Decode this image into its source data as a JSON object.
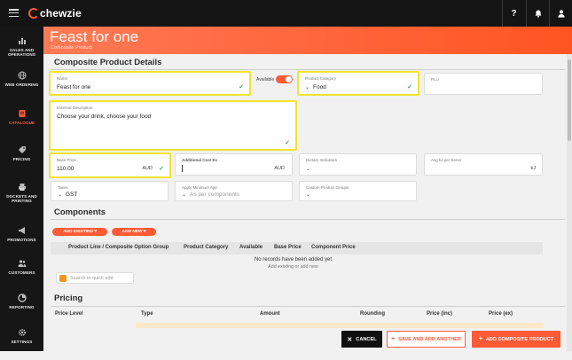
{
  "app": {
    "logo_text": "chewzie"
  },
  "header": {
    "title": "Feast for one",
    "subtitle": "Composite Product"
  },
  "sidebar": {
    "items": [
      {
        "label": "SALES AND OPERATIONS",
        "icon": "chart-icon"
      },
      {
        "label": "WEB ORDERING",
        "icon": "globe-icon"
      },
      {
        "label": "CATALOGUE",
        "icon": "catalogue-icon",
        "active": true
      },
      {
        "label": "PRICING",
        "icon": "tag-icon"
      },
      {
        "label": "DOCKETS AND PRINTING",
        "icon": "printer-icon"
      },
      {
        "label": "PROMOTIONS",
        "icon": "megaphone-icon"
      },
      {
        "label": "CUSTOMERS",
        "icon": "people-icon"
      },
      {
        "label": "REPORTING",
        "icon": "report-icon"
      },
      {
        "label": "SETTINGS",
        "icon": "gear-icon"
      }
    ]
  },
  "details": {
    "section_title": "Composite Product Details",
    "name": {
      "label": "Name",
      "value": "Feast for one"
    },
    "available": {
      "label": "Available",
      "on": true
    },
    "category": {
      "label": "Product Category",
      "value": "Food"
    },
    "plu": {
      "label": "PLU",
      "value": ""
    },
    "description": {
      "label": "External Description",
      "value": "Choose your drink, choose your food"
    },
    "base_price": {
      "label": "Base Price",
      "value": "110.00",
      "suffix": "AUD"
    },
    "additional_cost": {
      "label": "Additional Cost Ex",
      "value": "",
      "suffix": "AUD"
    },
    "dietary": {
      "label": "Dietary Indicators",
      "value": ""
    },
    "avg_kj": {
      "label": "Avg kJ per Serve",
      "value": "",
      "suffix": "kJ"
    },
    "taxes": {
      "label": "Taxes",
      "value": "GST"
    },
    "min_age": {
      "label": "Apply Minimum Age",
      "placeholder": "As per components"
    },
    "custom_groups": {
      "label": "Custom Product Groups",
      "value": ""
    }
  },
  "components": {
    "section_title": "Components",
    "add_existing": "ADD EXISTING",
    "add_new": "ADD NEW",
    "columns": [
      "Product Line / Composite Option Group",
      "Product Category",
      "Available",
      "Base Price",
      "Component Price"
    ],
    "empty_title": "No records have been added yet",
    "empty_sub": "Add existing or add new",
    "quick_add_placeholder": "Search to quick add"
  },
  "pricing": {
    "section_title": "Pricing",
    "columns": [
      "Price Level",
      "Type",
      "Amount",
      "Rounding",
      "Price (inc)",
      "Price (ex)"
    ]
  },
  "actions": {
    "cancel": "CANCEL",
    "save_add_another": "SAVE AND ADD ANOTHER",
    "add_composite": "ADD COMPOSITE PRODUCT"
  },
  "colors": {
    "accent": "#ff5a36",
    "highlight": "#f3e42b",
    "check": "#3aa35f",
    "sidebar_bg": "#161616"
  }
}
